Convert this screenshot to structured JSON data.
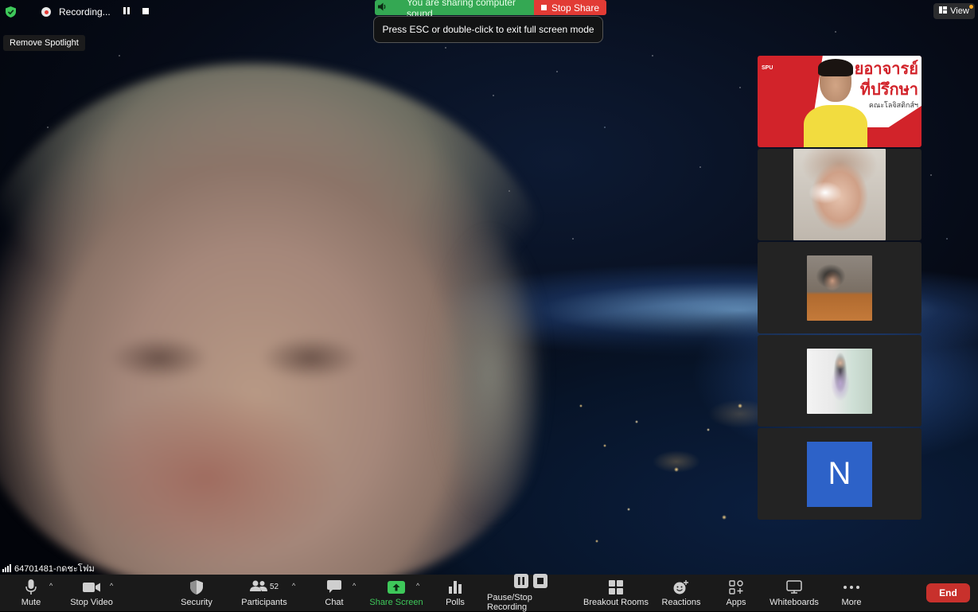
{
  "top": {
    "recording_label": "Recording...",
    "share_banner_text": "You are sharing computer sound",
    "stop_share_label": "Stop Share",
    "esc_tip": "Press ESC or double-click to exit full screen mode",
    "view_label": "View",
    "remove_spotlight": "Remove Spotlight"
  },
  "gallery": {
    "tile1_thai_line1": "ยอาจารย์",
    "tile1_thai_line2": "ที่ปรึกษา",
    "tile1_thai_small": "คณะโลจิสติกส์ฯ",
    "tile1_logo": "SPU",
    "tile5_initial": "N"
  },
  "speaker": {
    "name": "64701481-กดชะโฟม"
  },
  "toolbar": {
    "mute": "Mute",
    "stop_video": "Stop Video",
    "security": "Security",
    "participants": "Participants",
    "participants_count": "52",
    "chat": "Chat",
    "share_screen": "Share Screen",
    "polls": "Polls",
    "pause_stop_recording": "Pause/Stop Recording",
    "breakout_rooms": "Breakout Rooms",
    "reactions": "Reactions",
    "apps": "Apps",
    "whiteboards": "Whiteboards",
    "more": "More",
    "end": "End"
  },
  "colors": {
    "share_green": "#34a853",
    "stop_red": "#e23b35",
    "end_red": "#c8312c",
    "share_screen_green": "#3ec85a",
    "avatar_blue": "#2d62c8"
  }
}
